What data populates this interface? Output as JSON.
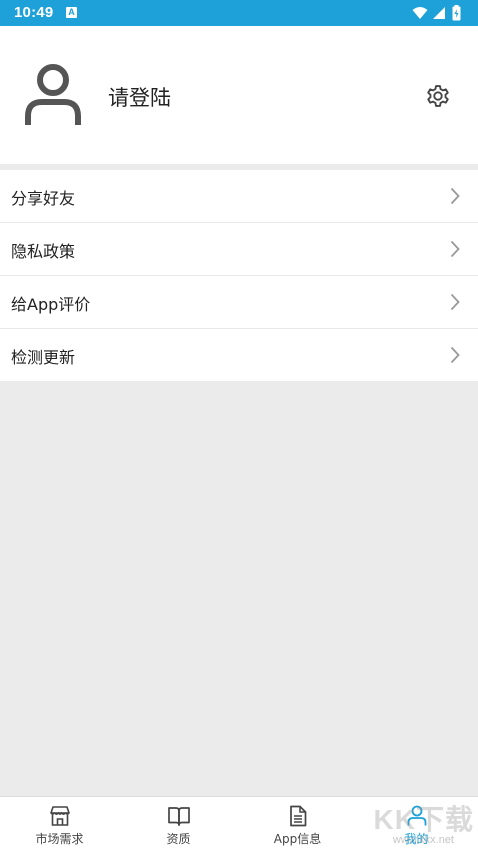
{
  "status_bar": {
    "time": "10:49",
    "notification_icon": "A",
    "icons": [
      "wifi-icon",
      "signal-icon",
      "battery-icon"
    ],
    "color": "#1ea0d8"
  },
  "profile": {
    "login_text": "请登陆",
    "avatar_icon": "user-icon",
    "settings_icon": "gear-icon"
  },
  "menu": {
    "items": [
      {
        "label": "分享好友"
      },
      {
        "label": "隐私政策"
      },
      {
        "label": "给App评价"
      },
      {
        "label": "检测更新"
      }
    ]
  },
  "tabbar": {
    "accent_color": "#1ea0d8",
    "tabs": [
      {
        "label": "市场需求",
        "icon": "store-icon",
        "active": false
      },
      {
        "label": "资质",
        "icon": "book-icon",
        "active": false
      },
      {
        "label": "App信息",
        "icon": "document-icon",
        "active": false
      },
      {
        "label": "我的",
        "icon": "person-icon",
        "active": true
      }
    ]
  },
  "watermark": {
    "text": "KK下载",
    "url": "www.kkx.net"
  }
}
